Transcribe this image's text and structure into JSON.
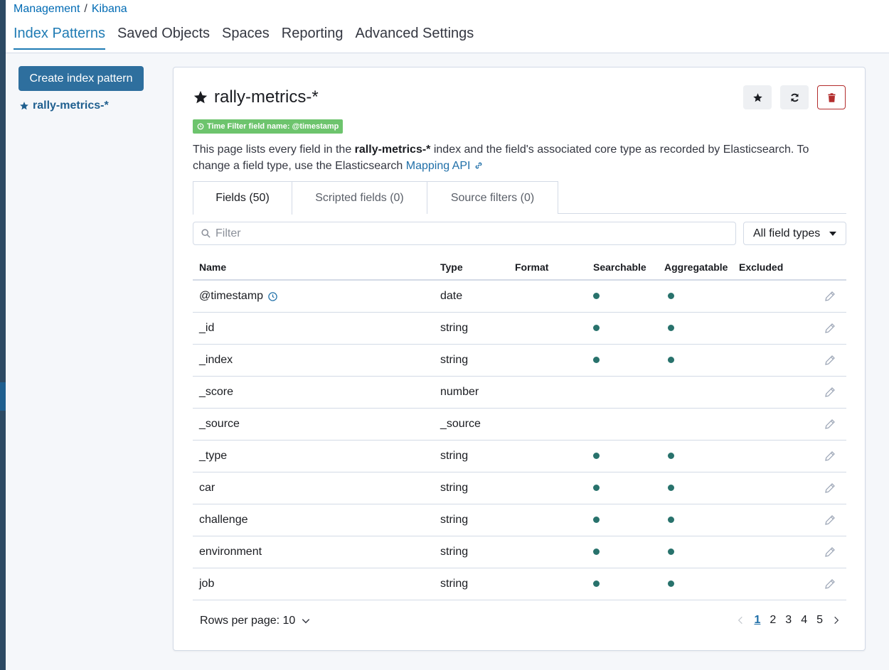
{
  "breadcrumb": {
    "root": "Management",
    "separator": "/",
    "current": "Kibana"
  },
  "nav_tabs": [
    {
      "label": "Index Patterns",
      "active": true
    },
    {
      "label": "Saved Objects",
      "active": false
    },
    {
      "label": "Spaces",
      "active": false
    },
    {
      "label": "Reporting",
      "active": false
    },
    {
      "label": "Advanced Settings",
      "active": false
    }
  ],
  "sidebar": {
    "create_button": "Create index pattern",
    "pattern_link": "rally-metrics-*"
  },
  "panel": {
    "title": "rally-metrics-*",
    "icons": {
      "title": "star-icon",
      "favorite": "star-icon",
      "refresh": "refresh-icon",
      "delete": "trash-icon"
    },
    "badge": "Time Filter field name: @timestamp",
    "description": {
      "before": "This page lists every field in the ",
      "bold": "rally-metrics-*",
      "after": " index and the field's associated core type as recorded by Elasticsearch. To change a field type, use the Elasticsearch ",
      "link": "Mapping API"
    },
    "tabs": [
      {
        "label": "Fields (50)",
        "active": true
      },
      {
        "label": "Scripted fields (0)",
        "active": false
      },
      {
        "label": "Source filters (0)",
        "active": false
      }
    ],
    "filter_placeholder": "Filter",
    "type_select": "All field types"
  },
  "table": {
    "columns": [
      "Name",
      "Type",
      "Format",
      "Searchable",
      "Aggregatable",
      "Excluded"
    ],
    "rows": [
      {
        "name": "@timestamp",
        "type": "date",
        "format": "",
        "searchable": true,
        "aggregatable": true,
        "time_field": true
      },
      {
        "name": "_id",
        "type": "string",
        "format": "",
        "searchable": true,
        "aggregatable": true
      },
      {
        "name": "_index",
        "type": "string",
        "format": "",
        "searchable": true,
        "aggregatable": true
      },
      {
        "name": "_score",
        "type": "number",
        "format": "",
        "searchable": false,
        "aggregatable": false
      },
      {
        "name": "_source",
        "type": "_source",
        "format": "",
        "searchable": false,
        "aggregatable": false
      },
      {
        "name": "_type",
        "type": "string",
        "format": "",
        "searchable": true,
        "aggregatable": true
      },
      {
        "name": "car",
        "type": "string",
        "format": "",
        "searchable": true,
        "aggregatable": true
      },
      {
        "name": "challenge",
        "type": "string",
        "format": "",
        "searchable": true,
        "aggregatable": true
      },
      {
        "name": "environment",
        "type": "string",
        "format": "",
        "searchable": true,
        "aggregatable": true
      },
      {
        "name": "job",
        "type": "string",
        "format": "",
        "searchable": true,
        "aggregatable": true
      }
    ]
  },
  "pagination": {
    "rows_per_page": "Rows per page: 10",
    "pages": [
      "1",
      "2",
      "3",
      "4",
      "5"
    ],
    "current_page": "1"
  },
  "colors": {
    "accent": "#1f7bb4",
    "primary_button": "#2e6f9e",
    "badge": "#6dc46d",
    "dot": "#28726c",
    "danger": "#b32d2d"
  }
}
